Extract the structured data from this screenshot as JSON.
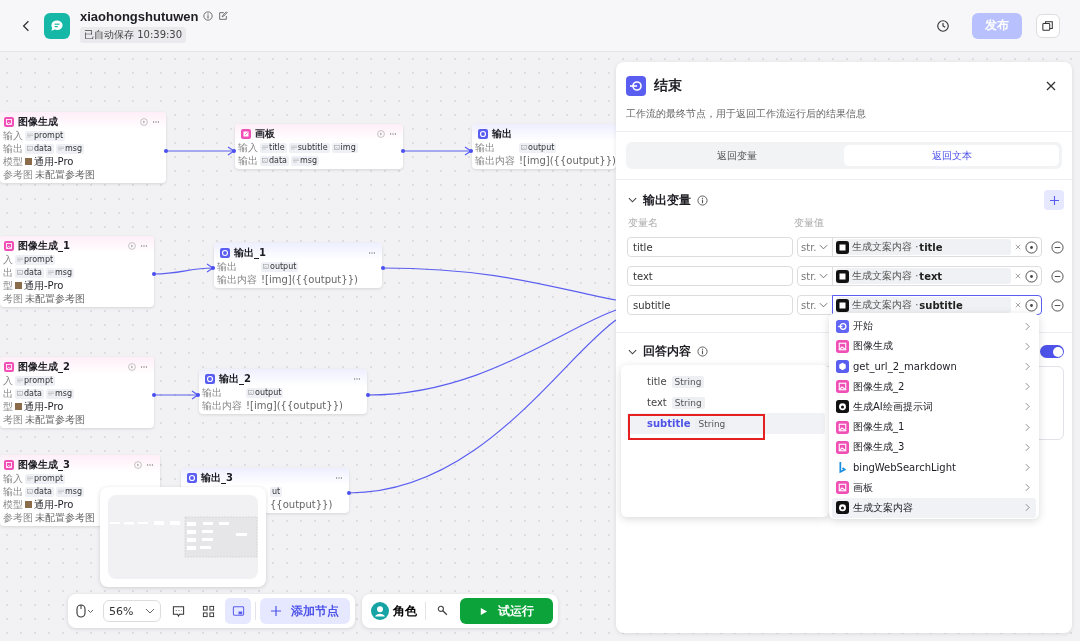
{
  "topbar": {
    "app_name": "xiaohongshutuwen",
    "saved": "已自动保存 10:39:30",
    "publish": "发布",
    "publish_disabled": true
  },
  "nodes": [
    {
      "kind": "image",
      "title": "图像生成",
      "rows": [
        {
          "label": "输入",
          "tags": [
            {
              "kind": "str",
              "text": "prompt"
            }
          ]
        },
        {
          "label": "输出",
          "tags": [
            {
              "kind": "img",
              "text": "data"
            },
            {
              "kind": "str",
              "text": "msg"
            }
          ]
        },
        {
          "label": "模型",
          "model": "通用-Pro"
        },
        {
          "label": "参考图",
          "note": "未配置参考图"
        }
      ]
    },
    {
      "kind": "board",
      "title": "画板",
      "rows": [
        {
          "label": "输入",
          "tags": [
            {
              "kind": "str",
              "text": "title"
            },
            {
              "kind": "str",
              "text": "subtitle"
            },
            {
              "kind": "img",
              "text": "img"
            }
          ]
        },
        {
          "label": "输出",
          "tags": [
            {
              "kind": "img",
              "text": "data"
            },
            {
              "kind": "str",
              "text": "msg"
            }
          ]
        }
      ]
    },
    {
      "kind": "output",
      "title": "输出",
      "rows": [
        {
          "label": "输出",
          "tags": [
            {
              "kind": "img",
              "text": "output"
            }
          ]
        },
        {
          "label": "输出内容",
          "note": "![img]({{output}})"
        }
      ]
    },
    {
      "kind": "image",
      "title": "图像生成_1",
      "rows": [
        {
          "label": "入",
          "tags": [
            {
              "kind": "str",
              "text": "prompt"
            }
          ]
        },
        {
          "label": "出",
          "tags": [
            {
              "kind": "img",
              "text": "data"
            },
            {
              "kind": "str",
              "text": "msg"
            }
          ]
        },
        {
          "label": "型",
          "model": "通用-Pro"
        },
        {
          "label": "考图",
          "note": "未配置参考图"
        }
      ]
    },
    {
      "kind": "output",
      "title": "输出_1",
      "rows": [
        {
          "label": "输出",
          "tags": [
            {
              "kind": "img",
              "text": "output"
            }
          ]
        },
        {
          "label": "输出内容",
          "note": "![img]({{output}})"
        }
      ]
    },
    {
      "kind": "image",
      "title": "图像生成_2",
      "rows": [
        {
          "label": "入",
          "tags": [
            {
              "kind": "str",
              "text": "prompt"
            }
          ]
        },
        {
          "label": "出",
          "tags": [
            {
              "kind": "img",
              "text": "data"
            },
            {
              "kind": "str",
              "text": "msg"
            }
          ]
        },
        {
          "label": "型",
          "model": "通用-Pro"
        },
        {
          "label": "考图",
          "note": "未配置参考图"
        }
      ]
    },
    {
      "kind": "output",
      "title": "输出_2",
      "rows": [
        {
          "label": "输出",
          "tags": [
            {
              "kind": "img",
              "text": "output"
            }
          ]
        },
        {
          "label": "输出内容",
          "note": "![img]({{output}})"
        }
      ]
    },
    {
      "kind": "image",
      "title": "图像生成_3",
      "rows": [
        {
          "label": "输入",
          "tags": [
            {
              "kind": "str",
              "text": "prompt"
            }
          ]
        },
        {
          "label": "输出",
          "tags": [
            {
              "kind": "img",
              "text": "data"
            },
            {
              "kind": "str",
              "text": "msg"
            }
          ]
        },
        {
          "label": "模型",
          "model": "通用-Pro"
        },
        {
          "label": "参考图",
          "note": "未配置参考图"
        }
      ]
    },
    {
      "kind": "output",
      "title": "输出_3",
      "rows": [
        {
          "tags": [
            {
              "kind": "cut",
              "text": "ut"
            }
          ]
        },
        {
          "note": "{{output}})"
        }
      ]
    }
  ],
  "panel": {
    "title": "结束",
    "description": "工作流的最终节点，用于返回工作流运行后的结果信息",
    "tabs": [
      {
        "label": "返回变量",
        "selected": false
      },
      {
        "label": "返回文本",
        "selected": true
      }
    ],
    "output_section": {
      "title": "输出变量",
      "expanded": true,
      "col_name": "变量名",
      "col_value": "变量值",
      "variables": [
        {
          "name": "title",
          "type": "str.",
          "source": "生成文案内容",
          "sep": "·",
          "field": "title",
          "focused": false
        },
        {
          "name": "text",
          "type": "str.",
          "source": "生成文案内容",
          "sep": "·",
          "field": "text",
          "focused": false
        },
        {
          "name": "subtitle",
          "type": "str.",
          "source": "生成文案内容",
          "sep": "·",
          "field": "subtitle",
          "focused": true
        }
      ]
    },
    "answer_section": {
      "title": "回答内容",
      "expanded": true,
      "toggle_on": true
    }
  },
  "field_menu": {
    "items": [
      {
        "name": "title",
        "type": "String",
        "selected": false
      },
      {
        "name": "text",
        "type": "String",
        "selected": false
      },
      {
        "name": "subtitle",
        "type": "String",
        "selected": true
      }
    ]
  },
  "node_menu": {
    "items": [
      {
        "kind": "start",
        "label": "开始",
        "hovered": false
      },
      {
        "kind": "image",
        "label": "图像生成",
        "hovered": false
      },
      {
        "kind": "plugin",
        "label": "get_url_2_markdown",
        "hovered": false
      },
      {
        "kind": "image",
        "label": "图像生成_2",
        "hovered": false
      },
      {
        "kind": "ai",
        "label": "生成AI绘画提示词",
        "hovered": false
      },
      {
        "kind": "image",
        "label": "图像生成_1",
        "hovered": false
      },
      {
        "kind": "image",
        "label": "图像生成_3",
        "hovered": false
      },
      {
        "kind": "bing",
        "label": "bingWebSearchLight",
        "hovered": false
      },
      {
        "kind": "board",
        "label": "画板",
        "hovered": false
      },
      {
        "kind": "ai",
        "label": "生成文案内容",
        "hovered": true
      }
    ]
  },
  "toolbar": {
    "zoom": "56%",
    "minimap_on": true,
    "add_node": "添加节点",
    "role": "角色",
    "run": "试运行"
  }
}
